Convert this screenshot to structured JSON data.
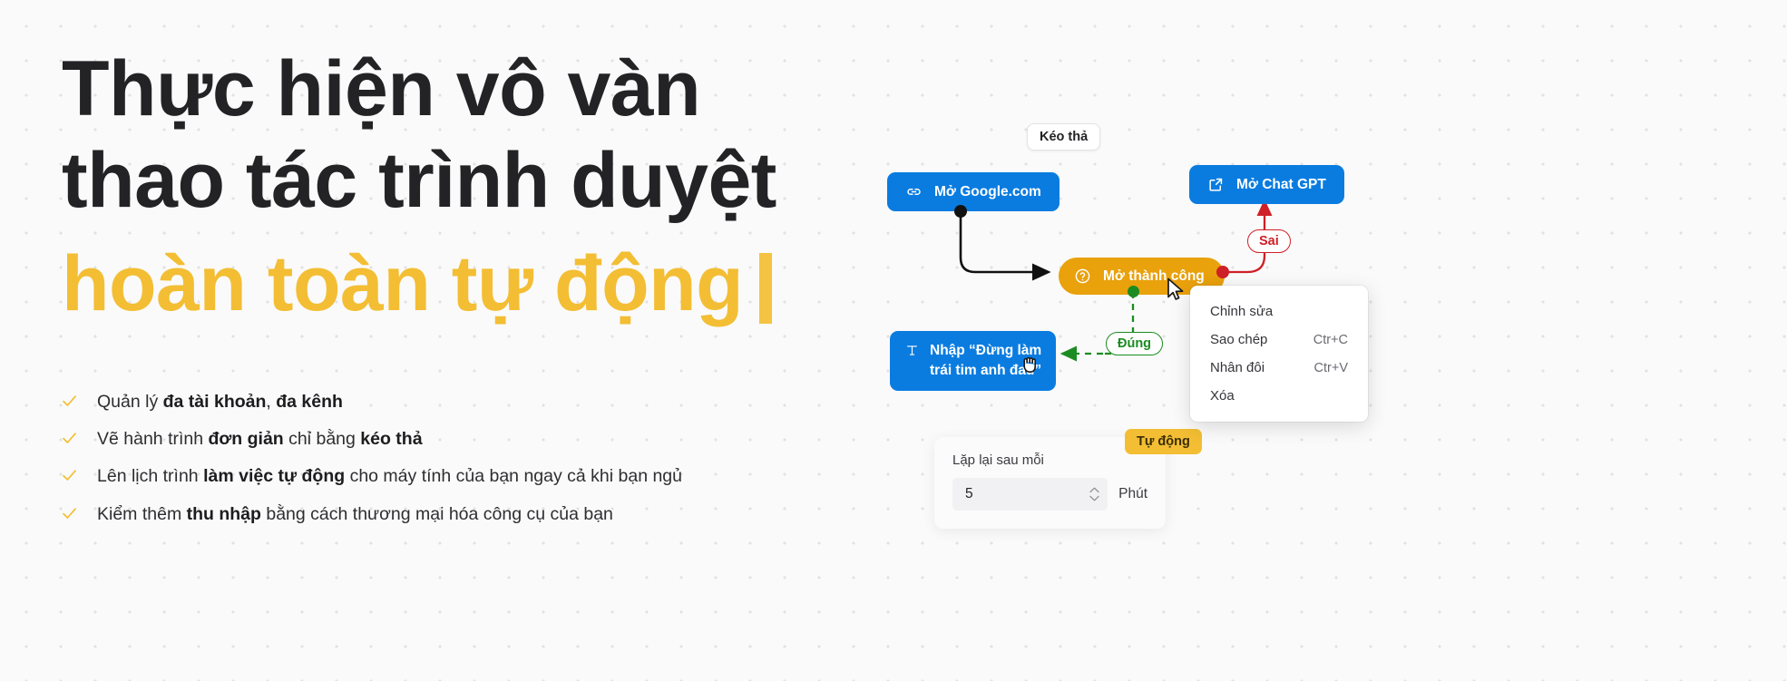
{
  "hero": {
    "heading_line_1": "Thực hiện vô vàn",
    "heading_line_2": "thao tác trình duyệt",
    "heading_line_3": "hoàn toàn tự động",
    "bullets": [
      {
        "prefix": "Quản lý ",
        "bold1": "đa tài khoản",
        "mid": ", ",
        "bold2": "đa kênh",
        "suffix": ""
      },
      {
        "prefix": "Vẽ hành trình ",
        "bold1": "đơn giản",
        "mid": " chỉ bằng ",
        "bold2": "kéo thả",
        "suffix": ""
      },
      {
        "prefix": "Lên lịch trình ",
        "bold1": "làm việc tự động",
        "mid": " cho máy tính của bạn ngay cả khi bạn ngủ",
        "bold2": "",
        "suffix": ""
      },
      {
        "prefix": "Kiểm thêm ",
        "bold1": "thu nhập",
        "mid": " bằng cách thương mại hóa công cụ của bạn",
        "bold2": "",
        "suffix": ""
      }
    ],
    "check_icon": "check-icon"
  },
  "flow": {
    "nodes": [
      {
        "id": "google",
        "label": "Mở Google.com",
        "icon": "link-icon"
      },
      {
        "id": "chatgpt",
        "label": "Mở Chat GPT",
        "icon": "external-link-icon"
      },
      {
        "id": "success",
        "label": "Mở thành công",
        "icon": "question-circle-icon"
      },
      {
        "id": "type",
        "label": "Nhập “Đừng làm\ntrái tim anh đau”",
        "icon": "text-icon"
      }
    ],
    "badges": {
      "drag_drop": "Kéo thả",
      "wrong": "Sai",
      "correct": "Đúng",
      "automatic": "Tự động"
    },
    "context_menu": [
      {
        "label": "Chỉnh sửa",
        "shortcut": ""
      },
      {
        "label": "Sao chép",
        "shortcut": "Ctr+C"
      },
      {
        "label": "Nhân đôi",
        "shortcut": "Ctr+V"
      },
      {
        "label": "Xóa",
        "shortcut": ""
      }
    ],
    "schedule": {
      "label": "Lặp lại sau mỗi",
      "value": "5",
      "unit": "Phút"
    },
    "cursors": [
      {
        "id": "arrow",
        "icon": "mouse-pointer-icon"
      },
      {
        "id": "grab",
        "icon": "grab-hand-icon"
      }
    ]
  },
  "colors": {
    "accent_yellow": "#F3BE34",
    "node_blue": "#0A7CE0",
    "node_amber": "#E9A10C",
    "error_red": "#CF2027",
    "success_green": "#1C8C22",
    "heading_dark": "#232326"
  }
}
